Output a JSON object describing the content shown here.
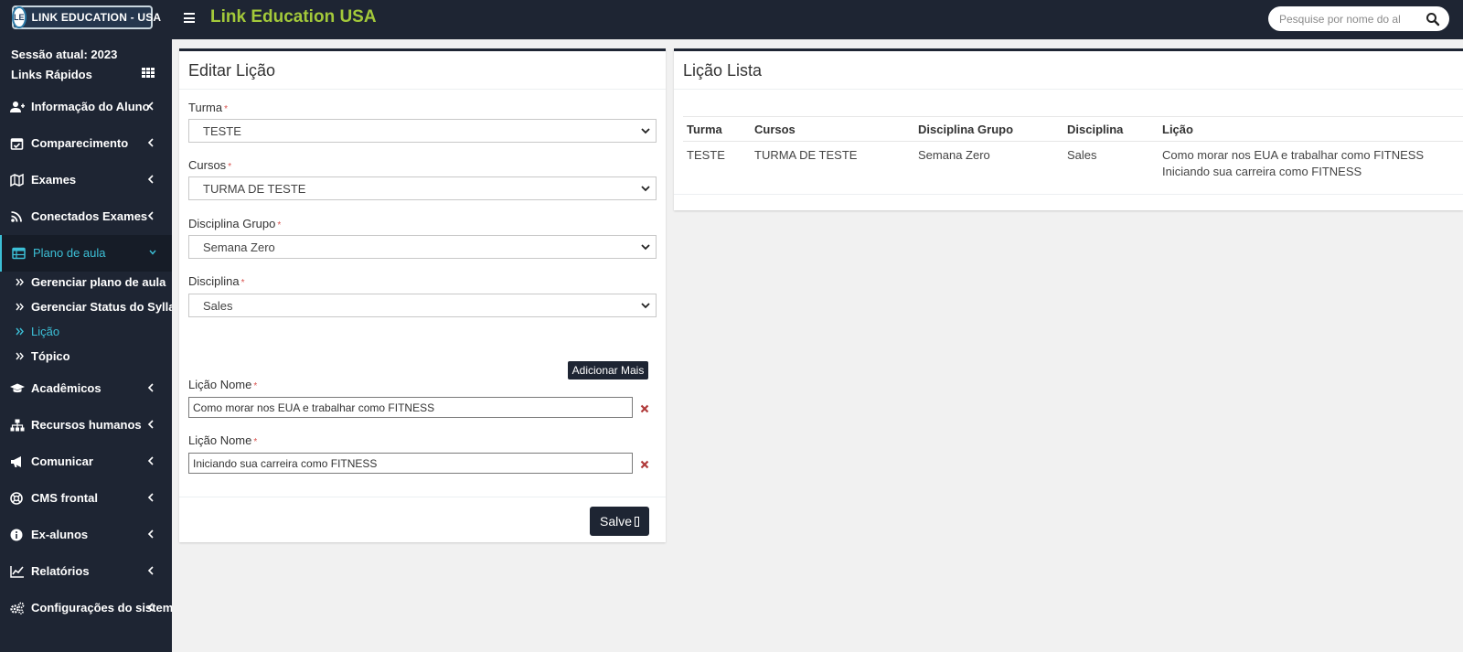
{
  "header": {
    "logo_mark": "LE",
    "logo_text": "LINK EDUCATION - USA",
    "app_title": "Link Education USA",
    "search_placeholder": "Pesquise por nome do al"
  },
  "sidebar": {
    "session": "Sessão atual: 2023",
    "quick_links": "Links Rápidos",
    "items": [
      {
        "label": "Informação do Aluno",
        "icon": "user-plus-icon"
      },
      {
        "label": "Comparecimento",
        "icon": "calendar-check-icon"
      },
      {
        "label": "Exames",
        "icon": "map-icon"
      },
      {
        "label": "Conectados Exames",
        "icon": "rss-icon"
      },
      {
        "label": "Plano de aula",
        "icon": "table-icon"
      },
      {
        "label": "Acadêmicos",
        "icon": "graduation-cap-icon"
      },
      {
        "label": "Recursos humanos",
        "icon": "sitemap-icon"
      },
      {
        "label": "Comunicar",
        "icon": "bullhorn-icon"
      },
      {
        "label": "CMS frontal",
        "icon": "life-ring-icon"
      },
      {
        "label": "Ex-alunos",
        "icon": "info-circle-icon"
      },
      {
        "label": "Relatórios",
        "icon": "line-chart-icon"
      },
      {
        "label": "Configurações do sistema",
        "icon": "cogs-icon"
      }
    ],
    "subitems": [
      {
        "label": "Gerenciar plano de aula"
      },
      {
        "label": "Gerenciar Status do Syllabus"
      },
      {
        "label": "Lição"
      },
      {
        "label": "Tópico"
      }
    ]
  },
  "edit_panel": {
    "title": "Editar Lição",
    "turma_label": "Turma",
    "turma_value": "TESTE",
    "cursos_label": "Cursos",
    "cursos_value": "TURMA DE TESTE",
    "grupo_label": "Disciplina Grupo",
    "grupo_value": "Semana Zero",
    "disciplina_label": "Disciplina",
    "disciplina_value": "Sales",
    "add_more": "Adicionar Mais",
    "licao_label": "Lição Nome",
    "licao_values": [
      "Como morar nos EUA e trabalhar como FITNESS",
      "Iniciando sua carreira como FITNESS"
    ],
    "save": "Salve",
    "required_mark": "*"
  },
  "list_panel": {
    "title": "Lição Lista",
    "columns": [
      "Turma",
      "Cursos",
      "Disciplina Grupo",
      "Disciplina",
      "Lição"
    ],
    "rows": [
      {
        "turma": "TESTE",
        "cursos": "TURMA DE TESTE",
        "grupo": "Semana Zero",
        "disciplina": "Sales",
        "licao": [
          "Como morar nos EUA e trabalhar como FITNESS",
          "Iniciando sua carreira como FITNESS"
        ]
      }
    ]
  },
  "colors": {
    "navbar": "#1e2533",
    "brand_title": "#a3c93a",
    "active_nav": "#3cbfd6",
    "required": "#d9534f",
    "delete": "#b03a3a"
  }
}
